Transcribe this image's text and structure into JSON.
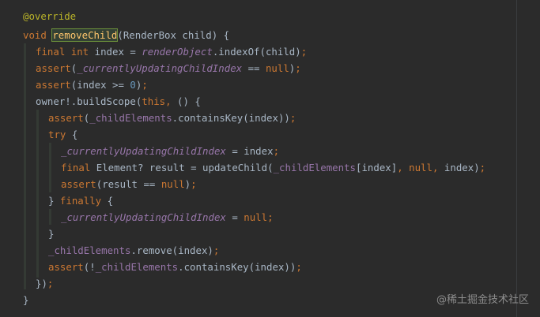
{
  "editor": {
    "lines": [
      [
        [
          "annotation",
          "@override"
        ]
      ],
      [
        [
          "kw",
          "void "
        ],
        [
          "hl-fn",
          "removeChild"
        ],
        [
          "txt",
          "(RenderBox child) {"
        ]
      ],
      [
        [
          "kw",
          "final "
        ],
        [
          "kw",
          "int "
        ],
        [
          "txt",
          "index = "
        ],
        [
          "field-it",
          "renderObject"
        ],
        [
          "txt",
          ".indexOf(child)"
        ],
        [
          "punct",
          ";"
        ]
      ],
      [
        [
          "kw",
          "assert"
        ],
        [
          "txt",
          "("
        ],
        [
          "field-it",
          "_currentlyUpdatingChildIndex"
        ],
        [
          "txt",
          " == "
        ],
        [
          "kw",
          "null"
        ],
        [
          "txt",
          ")"
        ],
        [
          "punct",
          ";"
        ]
      ],
      [
        [
          "kw",
          "assert"
        ],
        [
          "txt",
          "(index >= "
        ],
        [
          "num",
          "0"
        ],
        [
          "txt",
          ")"
        ],
        [
          "punct",
          ";"
        ]
      ],
      [
        [
          "txt",
          "owner!.buildScope("
        ],
        [
          "kw",
          "this"
        ],
        [
          "punct",
          ", "
        ],
        [
          "txt",
          "() {"
        ]
      ],
      [
        [
          "kw",
          "assert"
        ],
        [
          "txt",
          "("
        ],
        [
          "field",
          "_childElements"
        ],
        [
          "txt",
          ".containsKey(index))"
        ],
        [
          "punct",
          ";"
        ]
      ],
      [
        [
          "kw",
          "try "
        ],
        [
          "txt",
          "{"
        ]
      ],
      [
        [
          "field-it",
          "_currentlyUpdatingChildIndex"
        ],
        [
          "txt",
          " = index"
        ],
        [
          "punct",
          ";"
        ]
      ],
      [
        [
          "kw",
          "final "
        ],
        [
          "txt",
          "Element? result = updateChild("
        ],
        [
          "field",
          "_childElements"
        ],
        [
          "txt",
          "[index]"
        ],
        [
          "punct",
          ", "
        ],
        [
          "kw",
          "null"
        ],
        [
          "punct",
          ", "
        ],
        [
          "txt",
          "index)"
        ],
        [
          "punct",
          ";"
        ]
      ],
      [
        [
          "kw",
          "assert"
        ],
        [
          "txt",
          "(result == "
        ],
        [
          "kw",
          "null"
        ],
        [
          "txt",
          ")"
        ],
        [
          "punct",
          ";"
        ]
      ],
      [
        [
          "txt",
          "} "
        ],
        [
          "kw",
          "finally "
        ],
        [
          "txt",
          "{"
        ]
      ],
      [
        [
          "field-it",
          "_currentlyUpdatingChildIndex"
        ],
        [
          "txt",
          " = "
        ],
        [
          "kw",
          "null"
        ],
        [
          "punct",
          ";"
        ]
      ],
      [
        [
          "txt",
          "}"
        ]
      ],
      [
        [
          "field",
          "_childElements"
        ],
        [
          "txt",
          ".remove(index)"
        ],
        [
          "punct",
          ";"
        ]
      ],
      [
        [
          "kw",
          "assert"
        ],
        [
          "txt",
          "(!"
        ],
        [
          "field",
          "_childElements"
        ],
        [
          "txt",
          ".containsKey(index))"
        ],
        [
          "punct",
          ";"
        ]
      ],
      [
        [
          "txt",
          "})"
        ],
        [
          "punct",
          ";"
        ]
      ],
      [
        [
          "txt",
          "}"
        ]
      ]
    ]
  },
  "watermark": "@稀土掘金技术社区",
  "colors": {
    "background": "#2b2b2b",
    "text": "#a9b7c6",
    "keyword": "#cc7832",
    "function": "#ffc66d",
    "field": "#9876aa",
    "number": "#6897bb",
    "annotation": "#bbb529"
  }
}
